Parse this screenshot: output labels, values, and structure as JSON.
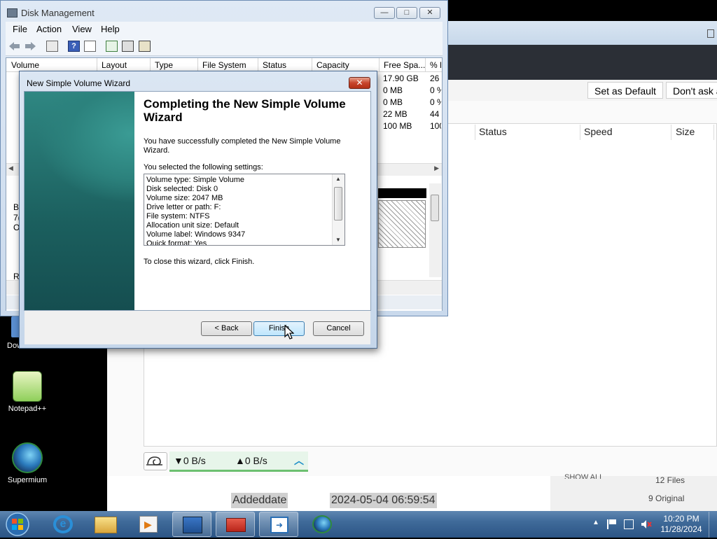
{
  "desktop": {
    "icons": [
      {
        "label": "Downlo..."
      },
      {
        "label": "Notepad++"
      },
      {
        "label": "Supermium"
      }
    ]
  },
  "bg_app": {
    "toolbar_buttons": {
      "set_default": "Set as Default",
      "dont_ask": "Don't ask a"
    },
    "columns": {
      "status": "Status",
      "speed": "Speed",
      "size": "Size"
    },
    "speed": {
      "down": "▼0 B/s",
      "up": "▲0 B/s"
    },
    "bottom": {
      "added_label": "Addeddate",
      "added_value": "2024-05-04 06:59:54",
      "show_all": "SHOW ALL",
      "files": "12 Files",
      "original": "9 Original"
    }
  },
  "disk_mgmt": {
    "title": "Disk Management",
    "menu": [
      "File",
      "Action",
      "View",
      "Help"
    ],
    "columns": [
      "Volume",
      "Layout",
      "Type",
      "File System",
      "Status",
      "Capacity",
      "Free Spa...",
      "% F"
    ],
    "free_space": [
      "17.90 GB",
      "0 MB",
      "0 MB",
      "22 MB",
      "100 MB"
    ],
    "percent_free": [
      "26",
      "0 %",
      "0 %",
      "44",
      "100"
    ],
    "lower_partial": [
      "B",
      "7(",
      "O",
      "R"
    ]
  },
  "wizard": {
    "title": "New Simple Volume Wizard",
    "heading": "Completing the New Simple Volume Wizard",
    "intro": "You have successfully completed the New Simple Volume Wizard.",
    "settings_label": "You selected the following settings:",
    "settings": [
      "Volume type: Simple Volume",
      "Disk selected: Disk 0",
      "Volume size: 2047 MB",
      "Drive letter or path: F:",
      "File system: NTFS",
      "Allocation unit size: Default",
      "Volume label: Windows 9347",
      "Quick format: Yes"
    ],
    "close_hint": "To close this wizard, click Finish.",
    "buttons": {
      "back": "< Back",
      "finish": "Finish",
      "cancel": "Cancel"
    }
  },
  "taskbar": {
    "time": "10:20 PM",
    "date": "11/28/2024"
  }
}
